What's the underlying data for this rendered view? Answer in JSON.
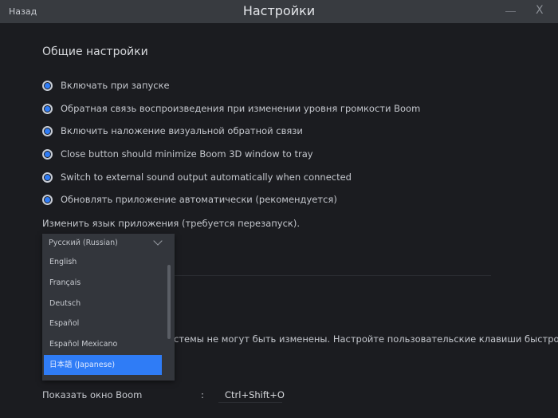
{
  "titlebar": {
    "back": "Назад",
    "title": "Настройки",
    "minimize": "—",
    "close": "X"
  },
  "section_title": "Общие настройки",
  "options": [
    {
      "label": "Включать при запуске",
      "checked": true
    },
    {
      "label": "Обратная связь воспроизведения при изменении уровня громкости Boom",
      "checked": true
    },
    {
      "label": "Включить наложение визуальной обратной связи",
      "checked": true
    },
    {
      "label": "Close button should minimize Boom 3D window to tray",
      "checked": true
    },
    {
      "label": "Switch to external sound output automatically when connected",
      "checked": true
    },
    {
      "label": "Обновлять приложение автоматически (рекомендуется)",
      "checked": true
    }
  ],
  "language": {
    "label": "Изменить язык приложения (требуется перезапуск).",
    "selected": "Русский (Russian)",
    "options": [
      "English",
      "Français",
      "Deutsch",
      "Español",
      "Español Mexicano",
      "日本語 (Japanese)"
    ],
    "highlighted": "日本語 (Japanese)"
  },
  "hotkeys": {
    "note": "стемы не могут быть изменены. Настройте пользовательские клавиши быстрого",
    "rows": [
      {
        "label": "Показать окно Boom",
        "separator": ":",
        "shortcut": "Ctrl+Shift+O"
      }
    ]
  },
  "colors": {
    "accent": "#2f7cf6",
    "background": "#1b1c20",
    "titlebar": "#383b40"
  }
}
